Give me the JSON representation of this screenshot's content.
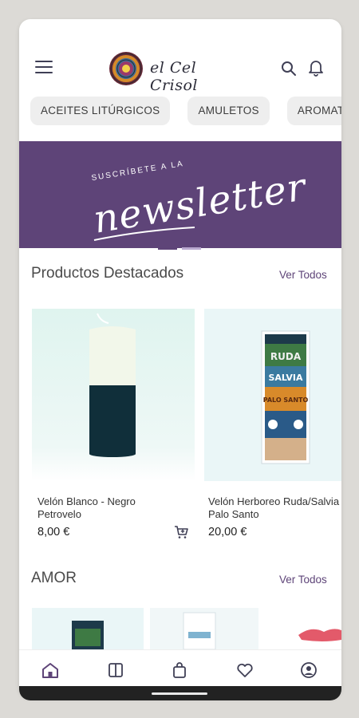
{
  "brand": {
    "name": "el Cel Crisol"
  },
  "categories": [
    "ACEITES LITÚRGICOS",
    "AMULETOS",
    "AROMATERA"
  ],
  "banner": {
    "subtitle": "SUSCRÍBETE A LA",
    "title": "newsletter"
  },
  "featured": {
    "title": "Productos Destacados",
    "see_all": "Ver Todos",
    "products": [
      {
        "name": "Velón Blanco - Negro\nPetrovelo",
        "price": "8,00 €"
      },
      {
        "name": "Velón Herboreo Ruda/Salvia\nPalo Santo",
        "price": "20,00 €"
      }
    ]
  },
  "amor": {
    "title": "AMOR",
    "see_all": "Ver Todos"
  },
  "package_labels": {
    "ruda": "RUDA",
    "salvia": "SALVIA",
    "palo_santo": "PALO SANTO"
  },
  "nav": [
    "home-icon",
    "book-icon",
    "bag-icon",
    "heart-icon",
    "account-icon"
  ],
  "colors": {
    "accent": "#5e4478",
    "banner": "#5e4478",
    "text": "#333333"
  }
}
